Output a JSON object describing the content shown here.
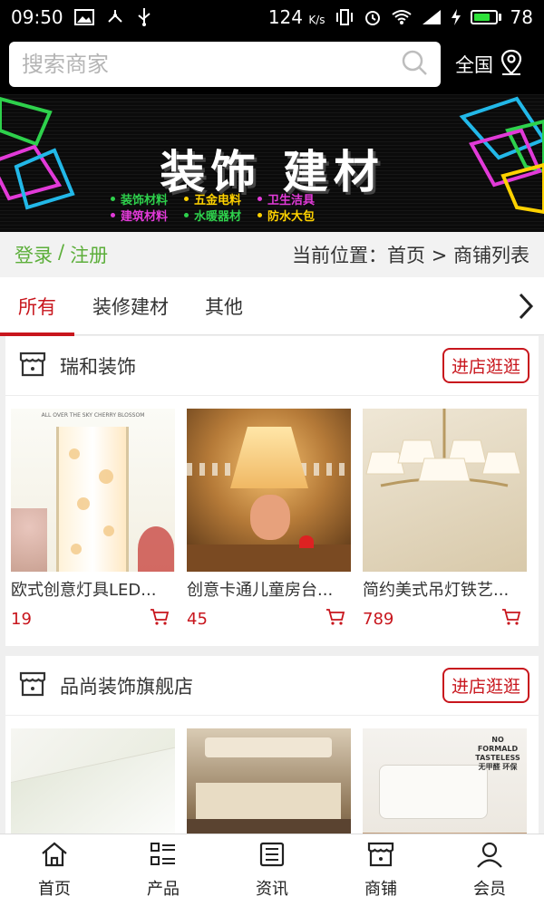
{
  "status": {
    "time": "09:50",
    "net_speed": "124",
    "net_unit": "K/s",
    "battery": "78",
    "battery_level": 0.78
  },
  "search": {
    "placeholder": "搜索商家",
    "region": "全国"
  },
  "banner": {
    "title": "装饰  建材",
    "tags": [
      {
        "label": "装饰材料",
        "color": "#2ed14c"
      },
      {
        "label": "五金电料",
        "color": "#ffd200"
      },
      {
        "label": "卫生洁具",
        "color": "#e23ad8"
      },
      {
        "label": "建筑材料",
        "color": "#e23ad8"
      },
      {
        "label": "水暖器材",
        "color": "#2ed14c"
      },
      {
        "label": "防水大包",
        "color": "#ffd200"
      }
    ]
  },
  "breadcrumb": {
    "login": "登录",
    "sep": "/",
    "register": "注册",
    "position": "当前位置：首页 > 商铺列表"
  },
  "tabs": [
    {
      "label": "所有",
      "active": true
    },
    {
      "label": "装修建材"
    },
    {
      "label": "其他"
    }
  ],
  "stores": [
    {
      "name": "瑞和装饰",
      "button": "进店逛逛",
      "products": [
        {
          "title": "欧式创意灯具LED...",
          "price": "19",
          "image_caption": "ALL OVER THE SKY CHERRY BLOSSOM"
        },
        {
          "title": "创意卡通儿童房台...",
          "price": "45"
        },
        {
          "title": "简约美式吊灯铁艺...",
          "price": "789"
        }
      ]
    },
    {
      "name": "品尚装饰旗舰店",
      "button": "进店逛逛",
      "products": [
        {
          "title": "",
          "price": ""
        },
        {
          "title": "",
          "price": ""
        },
        {
          "title": "",
          "price": "",
          "image_caption": "NO FORMALD TASTELESS 无甲醛 环保"
        }
      ]
    }
  ],
  "nav": [
    {
      "label": "首页"
    },
    {
      "label": "产品"
    },
    {
      "label": "资讯"
    },
    {
      "label": "商铺"
    },
    {
      "label": "会员"
    }
  ],
  "colors": {
    "accent": "#c8161d",
    "green": "#5cae3a"
  }
}
